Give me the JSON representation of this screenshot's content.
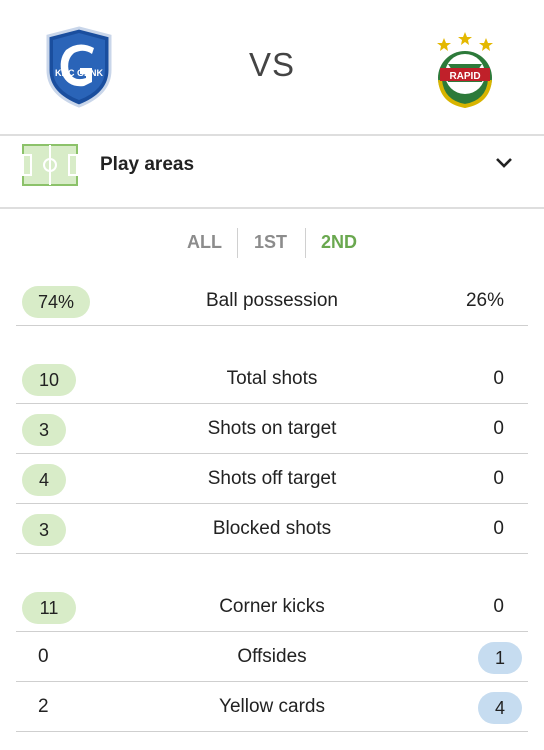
{
  "header": {
    "home_team": "KRC GENK",
    "vs_label": "VS",
    "away_team": "RAPID"
  },
  "play_areas": {
    "label": "Play areas"
  },
  "tabs": [
    {
      "label": "ALL",
      "active": false
    },
    {
      "label": "1ST",
      "active": false
    },
    {
      "label": "2ND",
      "active": true
    }
  ],
  "colors": {
    "accent": "#6aa84f",
    "home_highlight": "#d8ecc8",
    "away_highlight": "#c6dcf0"
  },
  "stats": [
    {
      "label": "Ball possession",
      "home": "74%",
      "away": "26%",
      "highlight": "home"
    },
    {
      "label": "Total shots",
      "home": "10",
      "away": "0",
      "highlight": "home"
    },
    {
      "label": "Shots on target",
      "home": "3",
      "away": "0",
      "highlight": "home"
    },
    {
      "label": "Shots off target",
      "home": "4",
      "away": "0",
      "highlight": "home"
    },
    {
      "label": "Blocked shots",
      "home": "3",
      "away": "0",
      "highlight": "home"
    },
    {
      "label": "Corner kicks",
      "home": "11",
      "away": "0",
      "highlight": "home"
    },
    {
      "label": "Offsides",
      "home": "0",
      "away": "1",
      "highlight": "away"
    },
    {
      "label": "Yellow cards",
      "home": "2",
      "away": "4",
      "highlight": "away"
    }
  ]
}
